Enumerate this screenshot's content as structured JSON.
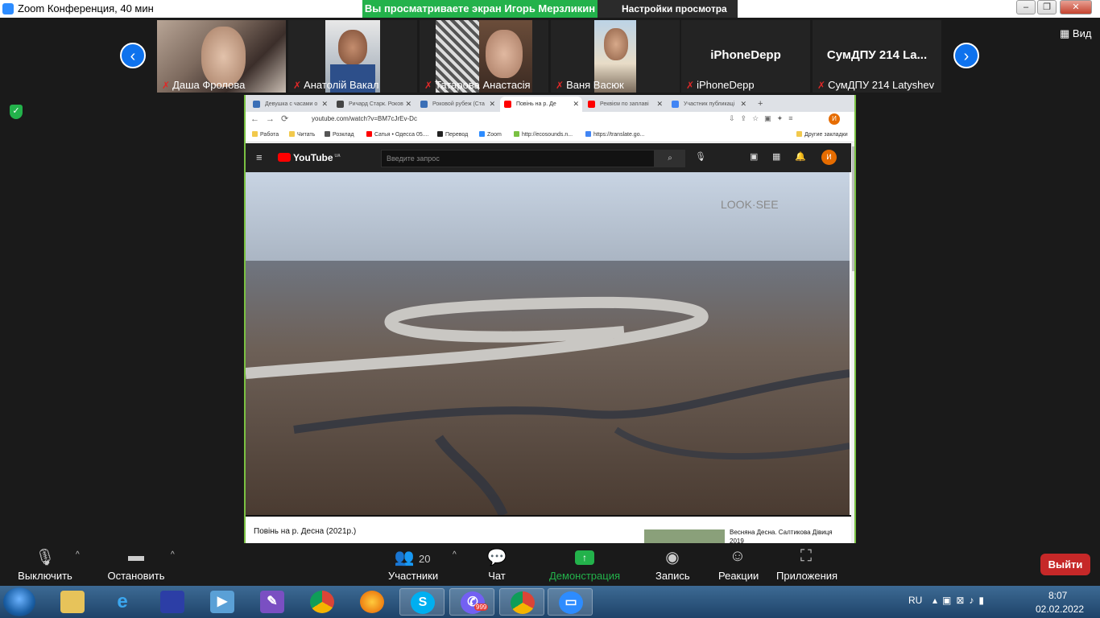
{
  "titlebar": {
    "app_title": "Zoom Конференция, 40 мин",
    "share_banner": "Вы просматриваете экран Игорь Мерзликин",
    "view_settings": "Настройки просмотра ⌄",
    "minimize": "–",
    "maximize": "❐",
    "close": "✕"
  },
  "gallery": {
    "view_label": "Вид",
    "prev_arrow": "‹",
    "next_arrow": "›",
    "participants": [
      {
        "name": "Даша Фролова"
      },
      {
        "name": "Анатолій Вакал"
      },
      {
        "name": "Татарова Анастасія"
      },
      {
        "name": "Ваня Васюк"
      },
      {
        "name": "iPhoneDepp",
        "big_name": "iPhoneDepp"
      },
      {
        "name": "СумДПУ 214 Latyshev",
        "big_name": "СумДПУ 214 La..."
      }
    ]
  },
  "browser": {
    "tabs": [
      {
        "label": "Девушка с часами о",
        "color": "#3b6fb6"
      },
      {
        "label": "Ричард Старк. Роков",
        "color": "#444444"
      },
      {
        "label": "Роковой рубеж (Ста",
        "color": "#3b6fb6"
      },
      {
        "label": "Повінь на р. Де",
        "color": "#ff0000"
      },
      {
        "label": "Реквієм по заплаві",
        "color": "#ff0000"
      },
      {
        "label": "Участник публикаці",
        "color": "#4285f4"
      }
    ],
    "new_tab": "+",
    "url": "youtube.com/watch?v=BM7cJrEv-Dc",
    "bookmarks": [
      {
        "label": "Работа",
        "color": "#f2c94c"
      },
      {
        "label": "Читать",
        "color": "#f2c94c"
      },
      {
        "label": "Розклад",
        "color": "#555555"
      },
      {
        "label": "Сатья • Одесса 05....",
        "color": "#ff0000"
      },
      {
        "label": "Перевод",
        "color": "#222222"
      },
      {
        "label": "Zoom",
        "color": "#2d8cff"
      },
      {
        "label": "http://ecosounds.n...",
        "color": "#7ac142"
      },
      {
        "label": "https://translate.go...",
        "color": "#4285f4"
      }
    ],
    "other_bookmarks": "Другие закладки",
    "youtube": {
      "logo": "YouTube",
      "region": "UA",
      "search_placeholder": "Введите запрос",
      "avatar_letter": "И",
      "video_title": "Повінь на р. Десна (2021р.)",
      "watermark": "LOOK·SEE",
      "related_title": "Весняна Десна. Салтикова Дівиця 2019"
    }
  },
  "toolbar": {
    "mute": "Выключить звук",
    "stop_video": "Остановить видео",
    "participants": "Участники",
    "participants_count": "20",
    "chat": "Чат",
    "share_screen": "Демонстрация экрана",
    "record": "Запись",
    "reactions": "Реакции",
    "apps": "Приложения",
    "leave": "Выйти"
  },
  "taskbar": {
    "language": "RU",
    "time": "8:07",
    "date": "02.02.2022",
    "viber_badge": "999"
  }
}
